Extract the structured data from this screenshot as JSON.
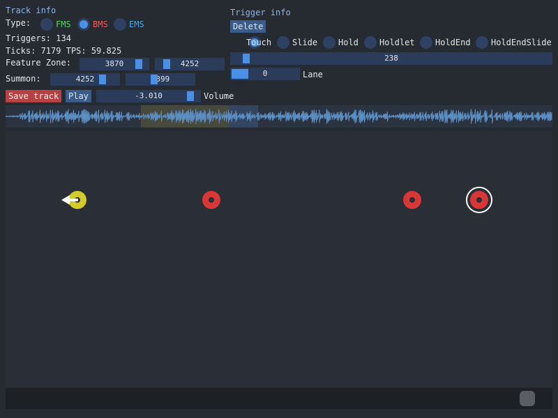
{
  "track_info": {
    "title": "Track info",
    "type_label": "Type:",
    "types": [
      {
        "label": "FMS",
        "color": "#4fd85b",
        "selected": false
      },
      {
        "label": "BMS",
        "color": "#ee5a5a",
        "selected": true
      },
      {
        "label": "EMS",
        "color": "#4aa6e0",
        "selected": false
      }
    ],
    "triggers_text": "Triggers: 134",
    "ticks_text": "Ticks:  7179 TPS: 59.825",
    "feature_zone_label": "Feature Zone:",
    "feature_zone_start": "3870",
    "feature_zone_end": "4252",
    "summon_label": "Summon:",
    "summon_start": "4252",
    "summon_end": "5399",
    "save_label": "Save track",
    "play_label": "Play",
    "volume_value": "-3.010",
    "volume_label": "Volume"
  },
  "trigger_info": {
    "title": "Trigger info",
    "delete_label": "Delete",
    "kinds": [
      {
        "label": "Touch",
        "selected": true
      },
      {
        "label": "Slide",
        "selected": false
      },
      {
        "label": "Hold",
        "selected": false
      },
      {
        "label": "Holdlet",
        "selected": false
      },
      {
        "label": "HoldEnd",
        "selected": false
      },
      {
        "label": "HoldEndSlide",
        "selected": false
      }
    ],
    "tick_value": "238",
    "lane_value": "0",
    "lane_label": "Lane"
  },
  "colors": {
    "accent": "#4a90e6",
    "waveform": "#5b8fc4",
    "feature_zone": "#6f6a3c",
    "trigger_touch": "#d93636",
    "trigger_slide": "#d3cc2a"
  }
}
